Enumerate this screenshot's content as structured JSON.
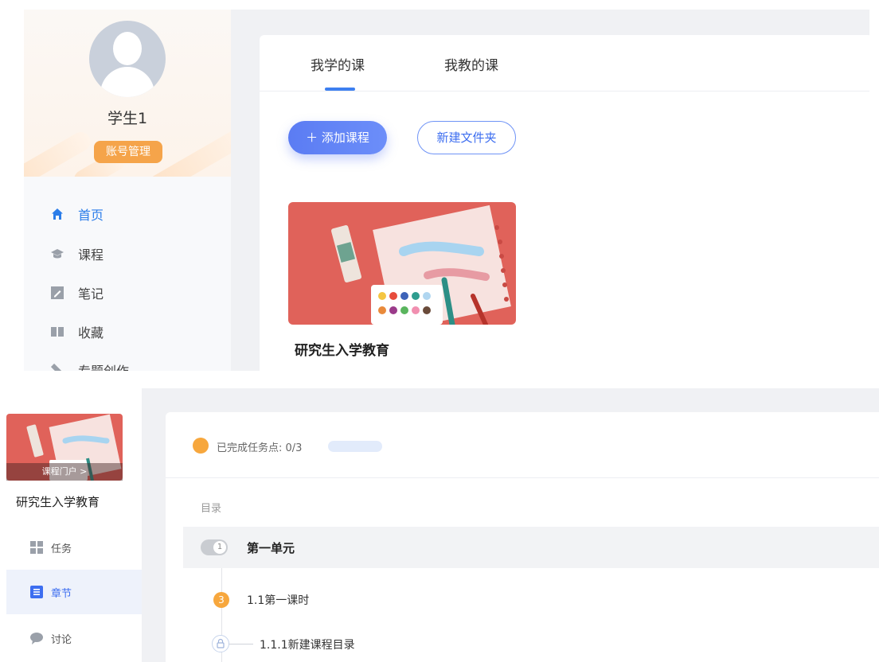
{
  "top": {
    "profile": {
      "username": "学生1",
      "account_button": "账号管理"
    },
    "nav": [
      {
        "label": "首页",
        "icon": "home-icon",
        "active": true
      },
      {
        "label": "课程",
        "icon": "mortarboard-icon",
        "active": false
      },
      {
        "label": "笔记",
        "icon": "note-icon",
        "active": false
      },
      {
        "label": "收藏",
        "icon": "book-icon",
        "active": false
      },
      {
        "label": "专题创作",
        "icon": "tools-icon",
        "active": false
      }
    ],
    "tabs": [
      {
        "label": "我学的课",
        "active": true
      },
      {
        "label": "我教的课",
        "active": false
      }
    ],
    "add_course_label": "添加课程",
    "new_folder_label": "新建文件夹",
    "course": {
      "title": "研究生入学教育"
    }
  },
  "bottom": {
    "course_portal_label": "课程门户 >",
    "course_title": "研究生入学教育",
    "nav": [
      {
        "label": "任务",
        "icon": "grid-icon",
        "active": false
      },
      {
        "label": "章节",
        "icon": "list-icon",
        "active": true
      },
      {
        "label": "讨论",
        "icon": "chat-icon",
        "active": false
      }
    ],
    "progress": {
      "text": "已完成任务点: 0/3",
      "completed": 0,
      "total": 3
    },
    "toc_label": "目录",
    "unit": {
      "number": "1",
      "title": "第一单元"
    },
    "lesson": {
      "badge": "3",
      "title": "1.1第一课时"
    },
    "sublesson": {
      "title": "1.1.1新建课程目录"
    }
  },
  "colors": {
    "accent": "#3d7ff0",
    "orange": "#f5a44a",
    "course_bg": "#e0625a"
  }
}
